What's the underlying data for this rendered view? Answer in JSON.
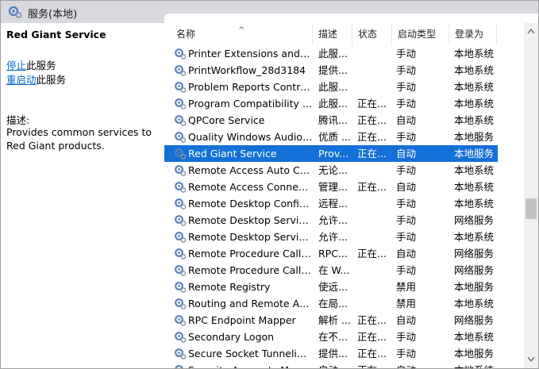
{
  "window": {
    "title": "服务(本地)"
  },
  "detail": {
    "service_name": "Red Giant Service",
    "stop_link": "停止",
    "stop_suffix": "此服务",
    "restart_link": "重启动",
    "restart_suffix": "此服务",
    "desc_label": "描述:",
    "desc_text": "Provides common services to Red Giant products."
  },
  "columns": {
    "name": "名称",
    "desc": "描述",
    "status": "状态",
    "startup": "启动类型",
    "logon": "登录为",
    "sort_indicator": "^"
  },
  "rows": [
    {
      "name": "Printer Extensions and N...",
      "desc": "此服...",
      "status": "",
      "startup": "手动",
      "logon": "本地系统"
    },
    {
      "name": "PrintWorkflow_28d3184",
      "desc": "提供...",
      "status": "",
      "startup": "手动",
      "logon": "本地系统"
    },
    {
      "name": "Problem Reports Control...",
      "desc": "此服...",
      "status": "",
      "startup": "手动",
      "logon": "本地系统"
    },
    {
      "name": "Program Compatibility A...",
      "desc": "此服...",
      "status": "正在...",
      "startup": "手动",
      "logon": "本地系统"
    },
    {
      "name": "QPCore Service",
      "desc": "腾讯...",
      "status": "正在...",
      "startup": "自动",
      "logon": "本地系统"
    },
    {
      "name": "Quality Windows Audio V...",
      "desc": "优质 ...",
      "status": "正在...",
      "startup": "手动",
      "logon": "本地服务"
    },
    {
      "name": "Red Giant Service",
      "desc": "Prov...",
      "status": "正在...",
      "startup": "自动",
      "logon": "本地服务",
      "selected": true
    },
    {
      "name": "Remote Access Auto Con...",
      "desc": "无论...",
      "status": "",
      "startup": "手动",
      "logon": "本地系统"
    },
    {
      "name": "Remote Access Connecti...",
      "desc": "管理...",
      "status": "正在...",
      "startup": "自动",
      "logon": "本地系统"
    },
    {
      "name": "Remote Desktop Configu...",
      "desc": "远程...",
      "status": "",
      "startup": "手动",
      "logon": "本地系统"
    },
    {
      "name": "Remote Desktop Services",
      "desc": "允许...",
      "status": "",
      "startup": "手动",
      "logon": "网络服务"
    },
    {
      "name": "Remote Desktop Service...",
      "desc": "允许...",
      "status": "",
      "startup": "手动",
      "logon": "本地系统"
    },
    {
      "name": "Remote Procedure Call (...",
      "desc": "RPC...",
      "status": "正在...",
      "startup": "自动",
      "logon": "网络服务"
    },
    {
      "name": "Remote Procedure Call (...",
      "desc": "在 W...",
      "status": "",
      "startup": "手动",
      "logon": "网络服务"
    },
    {
      "name": "Remote Registry",
      "desc": "使远...",
      "status": "",
      "startup": "禁用",
      "logon": "本地服务"
    },
    {
      "name": "Routing and Remote Acc...",
      "desc": "在局...",
      "status": "",
      "startup": "禁用",
      "logon": "本地系统"
    },
    {
      "name": "RPC Endpoint Mapper",
      "desc": "解析 ...",
      "status": "正在...",
      "startup": "自动",
      "logon": "网络服务"
    },
    {
      "name": "Secondary Logon",
      "desc": "在不...",
      "status": "正在...",
      "startup": "手动",
      "logon": "本地系统"
    },
    {
      "name": "Secure Socket Tunneling ...",
      "desc": "提供...",
      "status": "正在...",
      "startup": "手动",
      "logon": "本地服务"
    },
    {
      "name": "Security Accounts Manag...",
      "desc": "启动...",
      "status": "正在...",
      "startup": "自动",
      "logon": "本地系统"
    }
  ]
}
